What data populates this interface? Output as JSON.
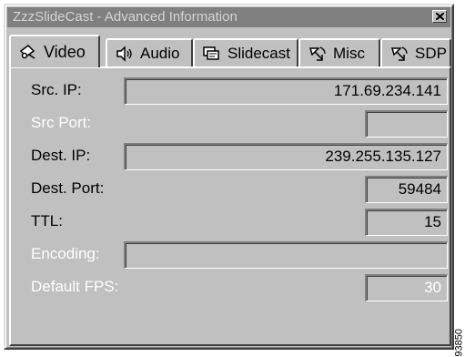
{
  "window": {
    "title": "ZzzSlideCast - Advanced Information",
    "close_icon": "close-icon"
  },
  "tabs": [
    {
      "label": "Video",
      "icon": "camera-icon",
      "active": true
    },
    {
      "label": "Audio",
      "icon": "speaker-icon",
      "active": false
    },
    {
      "label": "Slidecast",
      "icon": "slides-icon",
      "active": false
    },
    {
      "label": "Misc",
      "icon": "satellite-icon",
      "active": false
    },
    {
      "label": "SDP",
      "icon": "satellite-icon",
      "active": false
    }
  ],
  "fields": {
    "src_ip": {
      "label": "Src. IP:",
      "value": "171.69.234.141",
      "enabled": true
    },
    "src_port": {
      "label": "Src Port:",
      "value": "",
      "enabled": false
    },
    "dest_ip": {
      "label": "Dest. IP:",
      "value": "239.255.135.127",
      "enabled": true
    },
    "dest_port": {
      "label": "Dest. Port:",
      "value": "59484",
      "enabled": true
    },
    "ttl": {
      "label": "TTL:",
      "value": "15",
      "enabled": true
    },
    "encoding": {
      "label": "Encoding:",
      "value": "",
      "enabled": false
    },
    "default_fps": {
      "label": "Default FPS:",
      "value": "30",
      "enabled": false
    }
  },
  "watermark": "93850",
  "colors": {
    "face": "#c0c0c0",
    "title_inactive": "#808080",
    "disabled_text": "#ffffff"
  }
}
